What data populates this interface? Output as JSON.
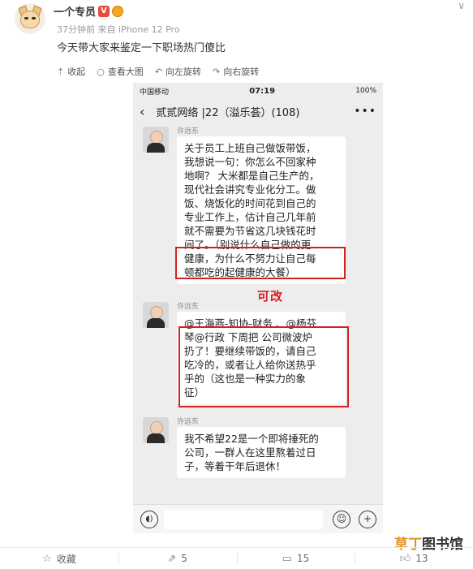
{
  "post": {
    "username": "一个专员",
    "verified_badge": "V",
    "meta": "37分钟前 来自 iPhone 12 Pro",
    "text": "今天带大家来鉴定一下职场热门傻比"
  },
  "image_toolbar": {
    "collapse": "收起",
    "view_large": "查看大图",
    "rotate_left": "向左旋转",
    "rotate_right": "向右旋转"
  },
  "screenshot": {
    "status": {
      "carrier": "中国移动",
      "time": "07:19",
      "battery": "100%"
    },
    "chat_title": "贰贰网络 |22（溢乐荟）(108)",
    "messages": [
      {
        "sender": "许远东",
        "lines": [
          "关于员工上班自己做饭带饭，",
          "我想说一句：你怎么不回家种",
          "地啊？ 大米都是自己生产的，",
          "现代社会讲究专业化分工。做",
          "饭、烧饭化的时间花到自己的",
          "专业工作上，估计自己几年前",
          "就不需要为节省这几块钱花时",
          "间了。（别说什么自己做的更",
          "健康，为什么不努力让自己每",
          "顿都吃的起健康的大餐）"
        ]
      },
      {
        "sender": "许远东",
        "lines": [
          "@王海燕-知协-财务 、@杨芬",
          "琴@行政 下周把 公司微波炉",
          "扔了！要继续带饭的，请自己",
          "吃冷的，或者让人给你送热乎",
          "乎的（这也是一种实力的象",
          "征）"
        ]
      },
      {
        "sender": "许远东",
        "lines": [
          "我不希望22是一个即将捶死的",
          "公司，一群人在这里熬着过日",
          "子，等着干年后退休！"
        ]
      }
    ],
    "stamp": "可改"
  },
  "watermark": {
    "part1": "草丁",
    "part2": "图书馆"
  },
  "actions": {
    "favorite": "收藏",
    "repost_count": "5",
    "comment_count": "15",
    "like_count": "13"
  },
  "colors": {
    "highlight": "#d62020",
    "badge": "#e8493a"
  }
}
